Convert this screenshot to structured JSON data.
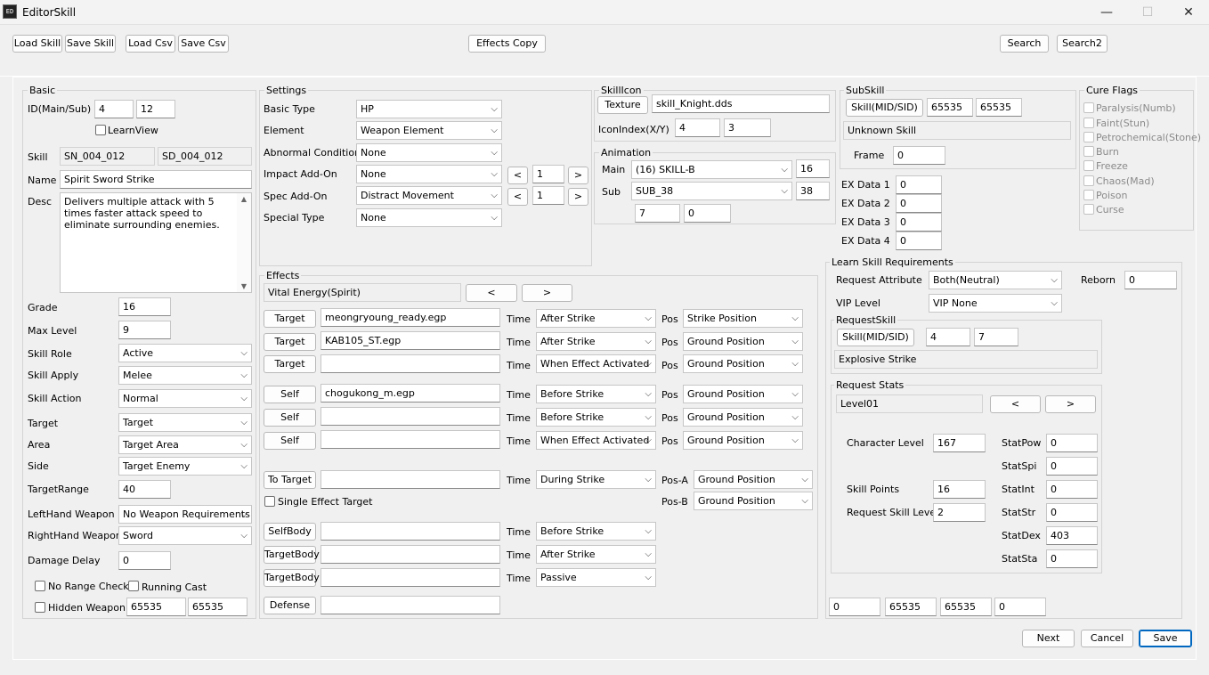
{
  "window": {
    "title": "EditorSkill",
    "min": "—",
    "max": "☐",
    "close": "✕",
    "icon": "editor-app-icon"
  },
  "toolbar": {
    "load_skill": "Load Skill",
    "save_skill": "Save Skill",
    "load_csv": "Load Csv",
    "save_csv": "Save Csv",
    "effects_copy": "Effects Copy",
    "search": "Search",
    "search2": "Search2"
  },
  "basic": {
    "title": "Basic",
    "id_label": "ID(Main/Sub)",
    "id_main": "4",
    "id_sub": "12",
    "learnview": "LearnView",
    "skill_label": "Skill",
    "skill_sn": "SN_004_012",
    "skill_sd": "SD_004_012",
    "name_label": "Name",
    "name": "Spirit Sword Strike",
    "desc_label": "Desc",
    "desc": "Delivers multiple attack with 5 times faster attack speed to eliminate surrounding enemies.",
    "grade_label": "Grade",
    "grade": "16",
    "maxlevel_label": "Max Level",
    "maxlevel": "9",
    "role_label": "Skill Role",
    "role": "Active",
    "apply_label": "Skill Apply",
    "apply": "Melee",
    "action_label": "Skill Action",
    "action": "Normal",
    "target_label": "Target",
    "target": "Target",
    "area_label": "Area",
    "area": "Target Area",
    "side_label": "Side",
    "side": "Target Enemy",
    "range_label": "TargetRange",
    "range": "40",
    "lefthand_label": "LeftHand Weapon",
    "lefthand": "No Weapon Requirements",
    "righthand_label": "RightHand Weapon",
    "righthand": "Sword",
    "delay_label": "Damage Delay",
    "delay": "0",
    "norange": "No Range Check",
    "running": "Running Cast",
    "hidden": "Hidden Weapon",
    "hidden_a": "65535",
    "hidden_b": "65535"
  },
  "settings": {
    "title": "Settings",
    "basic_type_label": "Basic Type",
    "basic_type": "HP",
    "element_label": "Element",
    "element": "Weapon Element",
    "abnormal_label": "Abnormal Condition",
    "abnormal": "None",
    "impact_label": "Impact Add-On",
    "impact": "None",
    "impact_val": "1",
    "spec_label": "Spec Add-On",
    "spec": "Distract Movement",
    "spec_val": "1",
    "special_label": "Special Type",
    "special": "None",
    "prev": "<",
    "next": ">"
  },
  "skillicon": {
    "title": "SkillIcon",
    "texture_btn": "Texture",
    "texture": "skill_Knight.dds",
    "iconindex_label": "IconIndex(X/Y)",
    "icon_x": "4",
    "icon_y": "3"
  },
  "animation": {
    "title": "Animation",
    "main_label": "Main",
    "main": "(16) SKILL-B",
    "main_val": "16",
    "sub_label": "Sub",
    "sub": "SUB_38",
    "sub_val": "38",
    "extra_a": "7",
    "extra_b": "0"
  },
  "subskill": {
    "title": "SubSkill",
    "btn": "Skill(MID/SID)",
    "mid": "65535",
    "sid": "65535",
    "name": "Unknown Skill",
    "frame_label": "Frame",
    "frame": "0"
  },
  "exdata": [
    {
      "label": "EX Data 1",
      "value": "0"
    },
    {
      "label": "EX Data 2",
      "value": "0"
    },
    {
      "label": "EX Data 3",
      "value": "0"
    },
    {
      "label": "EX Data 4",
      "value": "0"
    }
  ],
  "cure": {
    "title": "Cure Flags",
    "items": [
      "Paralysis(Numb)",
      "Faint(Stun)",
      "Petrochemical(Stone)",
      "Burn",
      "Freeze",
      "Chaos(Mad)",
      "Poison",
      "Curse"
    ]
  },
  "effects": {
    "title": "Effects",
    "vital": "Vital Energy(Spirit)",
    "prev": "<",
    "next": ">",
    "time_label": "Time",
    "pos_label": "Pos",
    "posa_label": "Pos-A",
    "posb_label": "Pos-B",
    "rows": [
      {
        "btn": "Target",
        "file": "meongryoung_ready.egp",
        "time": "After Strike",
        "pos": "Strike Position"
      },
      {
        "btn": "Target",
        "file": "KAB105_ST.egp",
        "time": "After Strike",
        "pos": "Ground Position"
      },
      {
        "btn": "Target",
        "file": "",
        "time": "When Effect Activated",
        "pos": "Ground Position"
      },
      {
        "btn": "Self",
        "file": "chogukong_m.egp",
        "time": "Before Strike",
        "pos": "Ground Position"
      },
      {
        "btn": "Self",
        "file": "",
        "time": "Before Strike",
        "pos": "Ground Position"
      },
      {
        "btn": "Self",
        "file": "",
        "time": "When Effect Activated",
        "pos": "Ground Position"
      }
    ],
    "totarget": {
      "btn": "To Target",
      "file": "",
      "time": "During Strike",
      "posa": "Ground Position",
      "posb": "Ground Position"
    },
    "single": "Single Effect Target",
    "body_rows": [
      {
        "btn": "SelfBody",
        "file": "",
        "time": "Before Strike"
      },
      {
        "btn": "TargetBody",
        "file": "",
        "time": "After Strike"
      },
      {
        "btn": "TargetBody",
        "file": "",
        "time": "Passive"
      }
    ],
    "defense": {
      "btn": "Defense",
      "file": ""
    }
  },
  "learn": {
    "title": "Learn Skill Requirements",
    "attr_label": "Request Attribute",
    "attr": "Both(Neutral)",
    "reborn_label": "Reborn",
    "reborn": "0",
    "vip_label": "VIP Level",
    "vip": "VIP None",
    "reqskill_title": "RequestSkill",
    "reqskill_btn": "Skill(MID/SID)",
    "reqskill_mid": "4",
    "reqskill_sid": "7",
    "reqskill_name": "Explosive Strike",
    "stats_title": "Request Stats",
    "level_name": "Level01",
    "prev": "<",
    "next": ">",
    "char_level_label": "Character Level",
    "char_level": "167",
    "skill_points_label": "Skill Points",
    "skill_points": "16",
    "req_skill_level_label": "Request Skill Level",
    "req_skill_level": "2",
    "stats": [
      {
        "label": "StatPow",
        "value": "0"
      },
      {
        "label": "StatSpi",
        "value": "0"
      },
      {
        "label": "StatInt",
        "value": "0"
      },
      {
        "label": "StatStr",
        "value": "0"
      },
      {
        "label": "StatDex",
        "value": "403"
      },
      {
        "label": "StatSta",
        "value": "0"
      }
    ],
    "bottom": [
      "0",
      "65535",
      "65535",
      "0"
    ]
  },
  "footer": {
    "next": "Next",
    "cancel": "Cancel",
    "save": "Save"
  }
}
